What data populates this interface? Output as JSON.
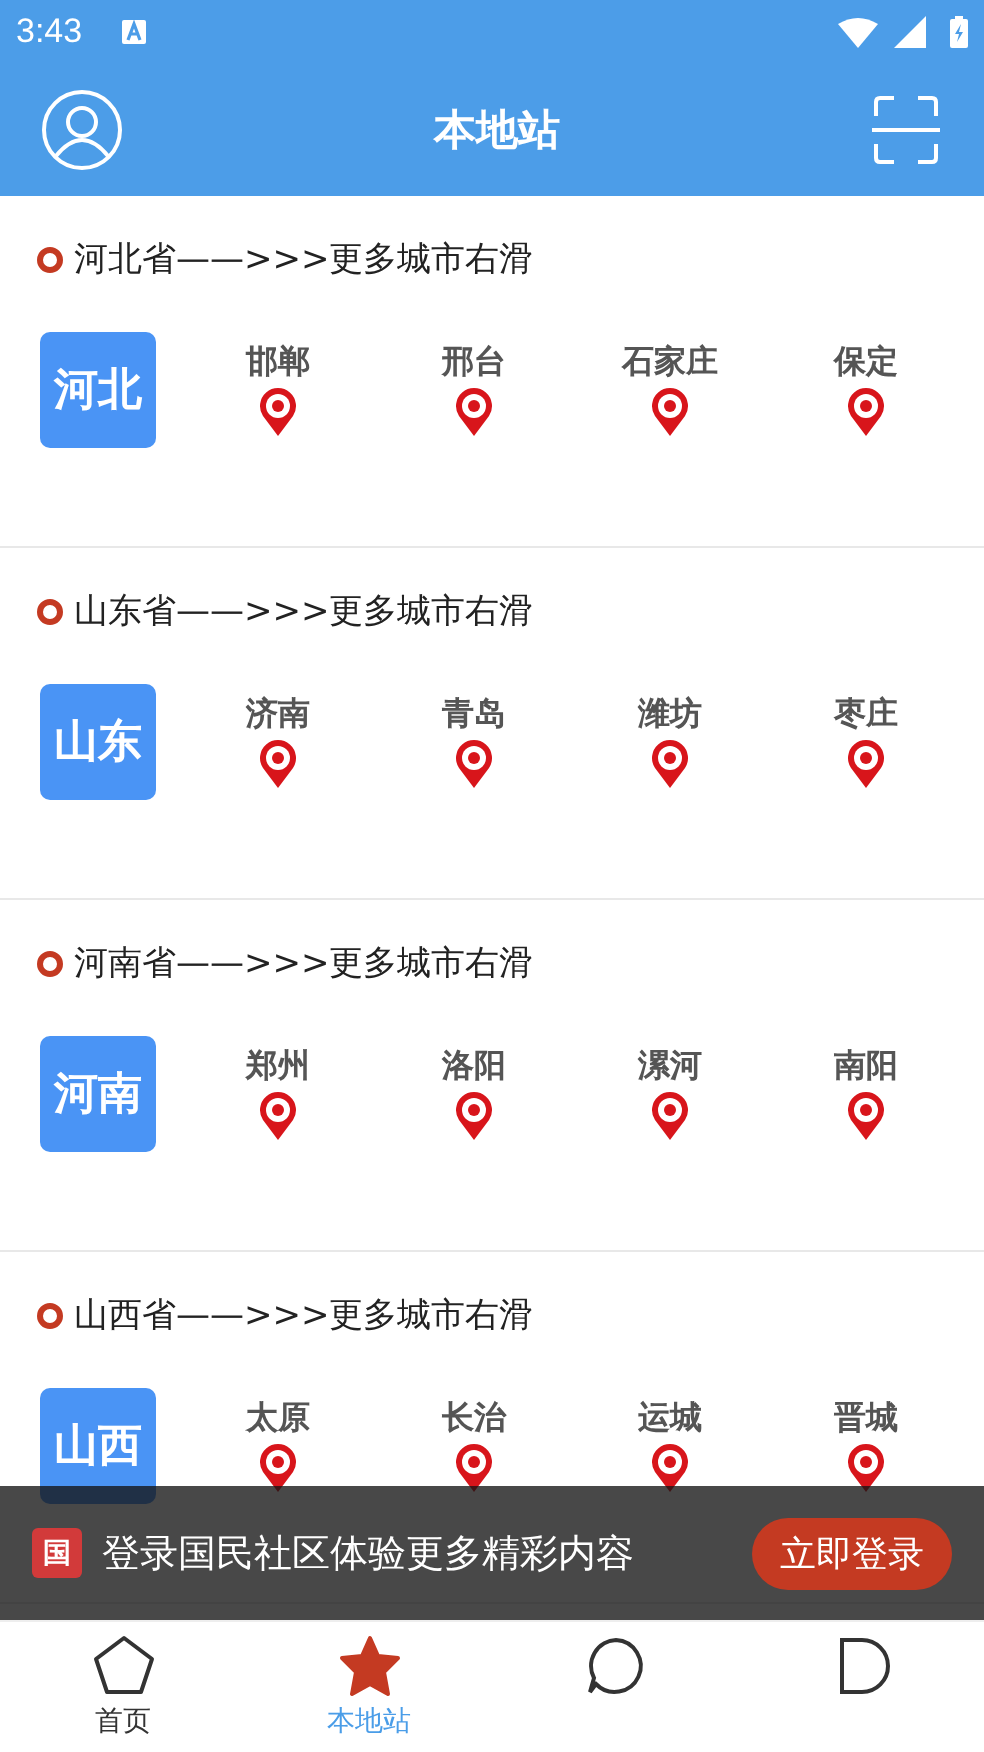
{
  "status_bar": {
    "time": "3:43"
  },
  "header": {
    "title": "本地站"
  },
  "provinces": [
    {
      "title": "河北省——>>>更多城市右滑",
      "badge": "河北",
      "cities": [
        "邯郸",
        "邢台",
        "石家庄",
        "保定"
      ]
    },
    {
      "title": "山东省——>>>更多城市右滑",
      "badge": "山东",
      "cities": [
        "济南",
        "青岛",
        "潍坊",
        "枣庄"
      ]
    },
    {
      "title": "河南省——>>>更多城市右滑",
      "badge": "河南",
      "cities": [
        "郑州",
        "洛阳",
        "漯河",
        "南阳"
      ]
    },
    {
      "title": "山西省——>>>更多城市右滑",
      "badge": "山西",
      "cities": [
        "太原",
        "长治",
        "运城",
        "晋城"
      ]
    }
  ],
  "login_banner": {
    "logo": "国",
    "text": "登录国民社区体验更多精彩内容",
    "button": "立即登录"
  },
  "bottom_nav": [
    {
      "kind": "home",
      "label": "首页",
      "selected": false
    },
    {
      "kind": "local",
      "label": "本地站",
      "selected": true
    },
    {
      "kind": "chat",
      "selected": false
    },
    {
      "kind": "profile",
      "selected": false
    }
  ]
}
